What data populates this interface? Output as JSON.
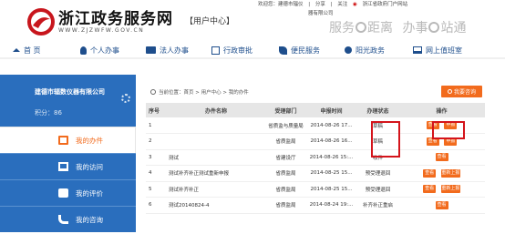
{
  "header": {
    "site_title": "浙江政务服务网",
    "site_url": "WWW.ZJZWFW.GOV.CN",
    "section": "【用户中心】",
    "welcome": "欢迎您：建德市辐仪",
    "company_line": "器有限公司",
    "share": "分享",
    "follow": "关注",
    "weibo": "浙江省政府门户网站",
    "slogan_left": "服务",
    "slogan_mid": "距离",
    "slogan_right": "办事",
    "slogan_end": "站通"
  },
  "nav": {
    "items": [
      {
        "label": "首 页",
        "icon": "home-icon"
      },
      {
        "label": "个人办事",
        "icon": "person-icon"
      },
      {
        "label": "法人办事",
        "icon": "id-card-icon"
      },
      {
        "label": "行政审批",
        "icon": "edit-icon"
      },
      {
        "label": "便民服务",
        "icon": "leaf-icon"
      },
      {
        "label": "阳光政务",
        "icon": "sun-icon"
      },
      {
        "label": "网上值班室",
        "icon": "monitor-icon"
      }
    ]
  },
  "sidebar": {
    "company": "建德市辐数仪器有限公司",
    "points": "积分：86",
    "menu": [
      {
        "label": "我的办件",
        "icon": "edit-icon",
        "active": true
      },
      {
        "label": "我的访问",
        "icon": "monitor-icon",
        "active": false
      },
      {
        "label": "我的评价",
        "icon": "chat-icon",
        "active": false
      },
      {
        "label": "我的咨询",
        "icon": "phone-icon",
        "active": false
      }
    ]
  },
  "breadcrumb": {
    "text": "当前位置：首页 > 用户中心 > 我的办件"
  },
  "ask_button": "我要咨询",
  "table": {
    "headers": [
      "序号",
      "办件名称",
      "受理部门",
      "申报时间",
      "办理状态",
      "操作"
    ],
    "rows": [
      {
        "no": "1",
        "name": "",
        "dept": "省质监与质量局",
        "time": "2014-08-26 17...",
        "status": "草稿",
        "actions": [
          "查看",
          "申报"
        ]
      },
      {
        "no": "2",
        "name": "",
        "dept": "省质监局",
        "time": "2014-08-26 16...",
        "status": "草稿",
        "actions": [
          "查看",
          "申报"
        ]
      },
      {
        "no": "3",
        "name": "测试",
        "dept": "省建设厅",
        "time": "2014-08-26 15:...",
        "status": "收件",
        "actions": [
          "查看"
        ]
      },
      {
        "no": "4",
        "name": "测试补齐补正测试重新申报",
        "dept": "省质监局",
        "time": "2014-08-25 15...",
        "status": "预受理退回",
        "actions": [
          "查看",
          "重新上报"
        ]
      },
      {
        "no": "5",
        "name": "测试补齐补正",
        "dept": "省质监局",
        "time": "2014-08-25 15...",
        "status": "预受理退回",
        "actions": [
          "查看",
          "重新上报"
        ]
      },
      {
        "no": "6",
        "name": "测试20140824-4",
        "dept": "省质监局",
        "time": "2014-08-24 19:...",
        "status": "补齐补正重启",
        "actions": [
          "查看"
        ]
      }
    ]
  },
  "colors": {
    "brand_blue": "#2a6ebd",
    "accent_orange": "#f26b1d",
    "highlight_red": "#d4141b"
  }
}
